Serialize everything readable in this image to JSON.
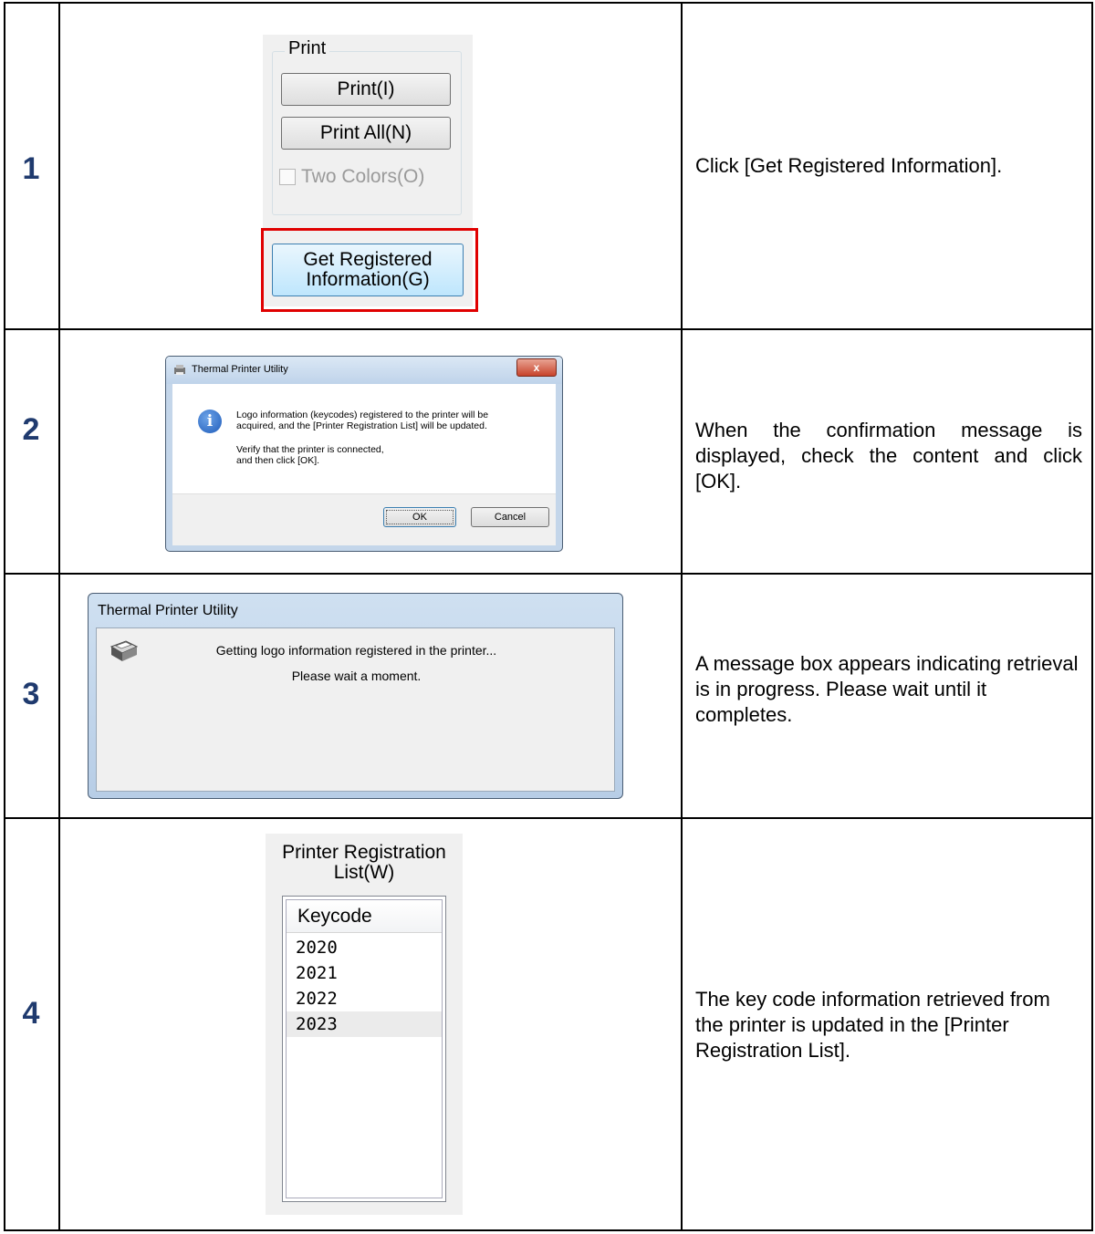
{
  "steps": [
    {
      "number": "1",
      "description": "Click [Get Registered Information]."
    },
    {
      "number": "2",
      "description": "When the confirmation message is displayed, check the content and click [OK]."
    },
    {
      "number": "3",
      "description": "A message box appears indicating retrieval is in progress. Please wait until it completes."
    },
    {
      "number": "4",
      "description": "The key code information retrieved from the printer is updated in the [Printer Registration List]."
    }
  ],
  "step1": {
    "group_label": "Print",
    "print_button": "Print(I)",
    "print_all_button": "Print All(N)",
    "two_colors_checkbox": "Two Colors(O)",
    "get_registered_line1": "Get Registered",
    "get_registered_line2": "Information(G)"
  },
  "step2": {
    "title": "Thermal Printer Utility",
    "close": "x",
    "line1": "Logo information (keycodes) registered to the printer will be",
    "line2": "acquired, and the [Printer Registration List] will be updated.",
    "line3": "Verify that the printer is connected,",
    "line4": "and then click [OK].",
    "ok": "OK",
    "cancel": "Cancel"
  },
  "step3": {
    "title": "Thermal Printer Utility",
    "line1": "Getting logo information registered in the printer...",
    "line2": "Please wait a moment."
  },
  "step4": {
    "title_line1": "Printer Registration",
    "title_line2": "List(W)",
    "header": "Keycode",
    "items": [
      "2020",
      "2021",
      "2022",
      "2023"
    ]
  },
  "colors": {
    "step_number": "#1f3a6e",
    "highlight": "#e00000"
  }
}
